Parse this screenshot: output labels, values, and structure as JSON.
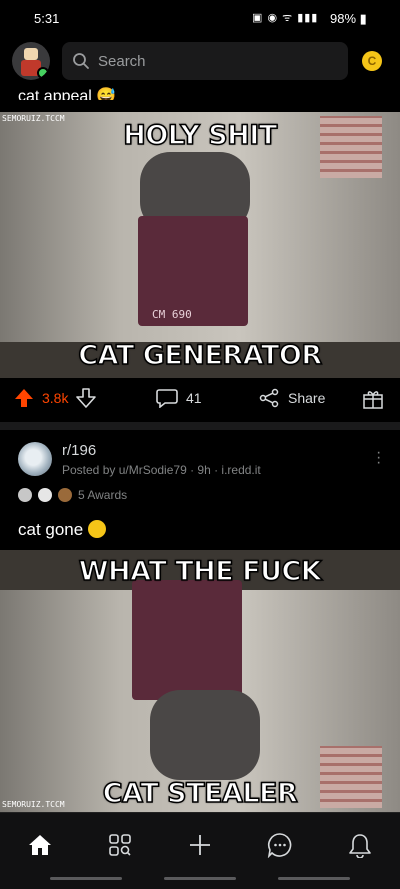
{
  "status_bar": {
    "time": "5:31",
    "battery": "98%"
  },
  "search": {
    "placeholder": "Search"
  },
  "header": {
    "coin_symbol": "C"
  },
  "post1": {
    "caption_partial": "cat appeal 😅",
    "meme_top_text": "HOLY SHIT",
    "meme_bottom_text": "CAT GENERATOR",
    "box_text": "CM 690",
    "watermark": "SEMORUIZ.TCCM",
    "actions": {
      "upvotes": "3.8k",
      "comments": "41",
      "share": "Share"
    }
  },
  "post2": {
    "subreddit": "r/196",
    "meta": "Posted by u/MrSodie79 · 9h · i.redd.it",
    "awards": "5 Awards",
    "title": "cat gone",
    "meme_top_text": "WHAT THE FUCK",
    "meme_bottom_text": "CAT STEALER",
    "watermark": "SEMORUIZ.TCCM"
  },
  "colors": {
    "upvote": "#ff4500",
    "background": "#000000",
    "muted": "#818384",
    "online": "#46d160"
  },
  "navbar": {
    "items": [
      "home-icon",
      "communities-icon",
      "create-icon",
      "chat-icon",
      "notifications-icon"
    ]
  }
}
